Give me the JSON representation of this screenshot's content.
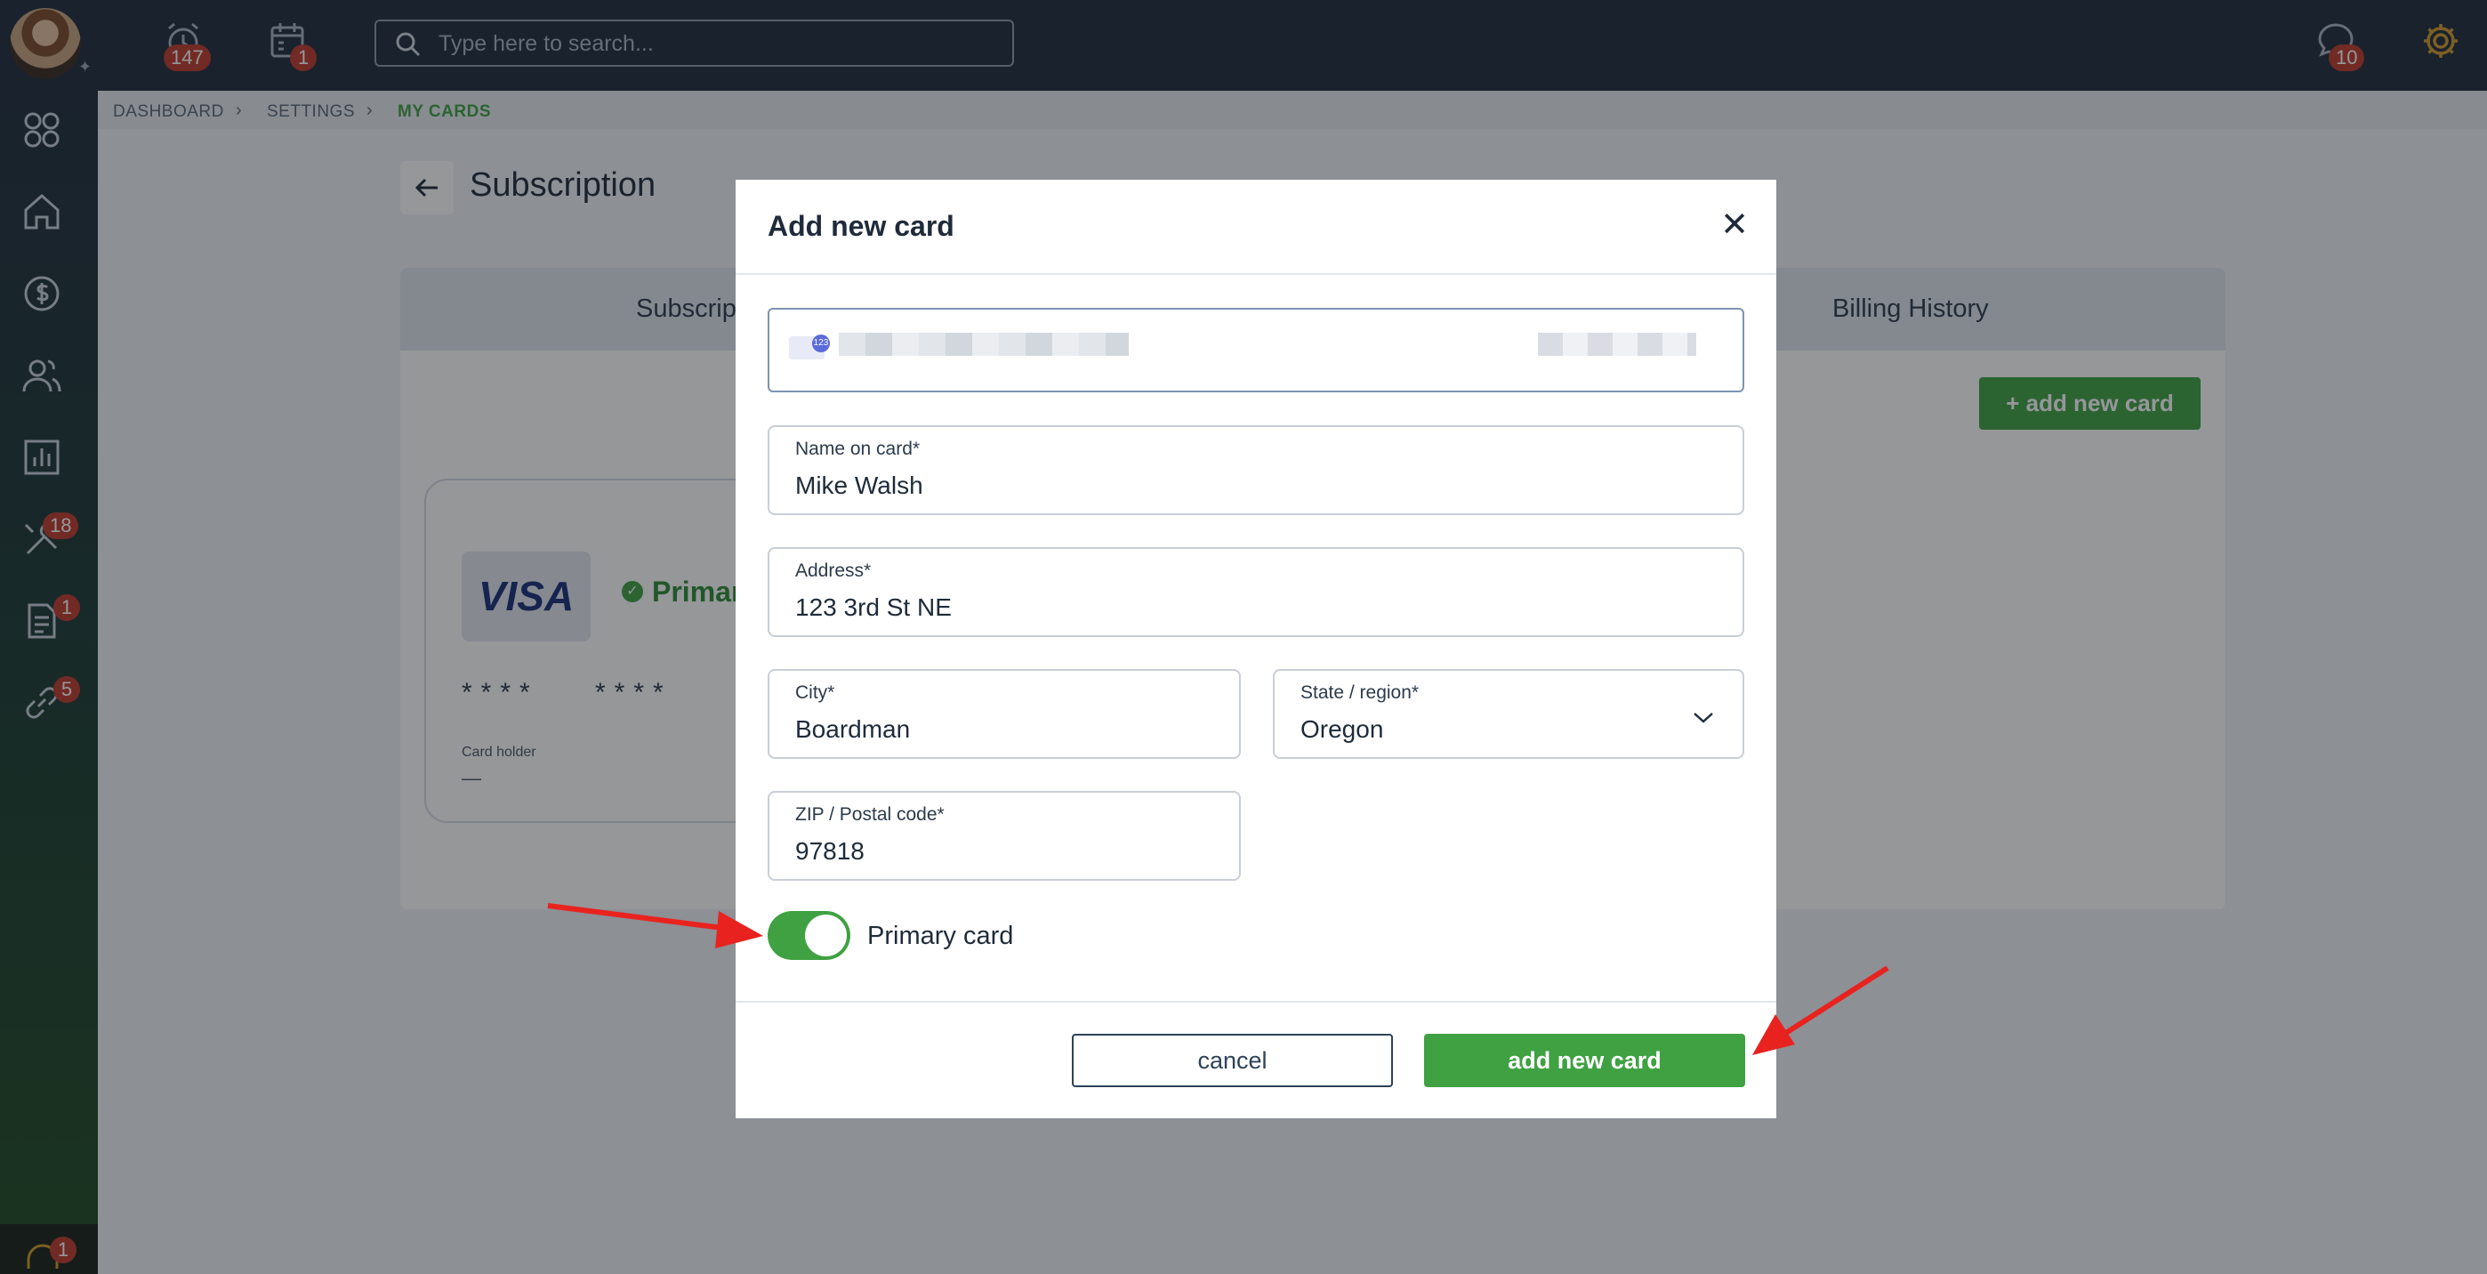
{
  "topbar": {
    "search_placeholder": "Type here to search...",
    "alarm_badge": "147",
    "calendar_badge": "1",
    "messages_badge": "10"
  },
  "sidebar": {
    "tools_badge": "18",
    "documents_badge": "1",
    "links_badge": "5",
    "support_badge": "1"
  },
  "breadcrumb": [
    "DASHBOARD",
    "SETTINGS",
    "MY CARDS"
  ],
  "page": {
    "title": "Subscription",
    "tabs": [
      "Subscrip",
      "Billing History"
    ],
    "add_card_label": "+ add new card",
    "card": {
      "brand": "VISA",
      "primary_label": "Primary",
      "masked_1": "****",
      "masked_2": "****",
      "holder_label": "Card holder",
      "holder_value": "—"
    }
  },
  "modal": {
    "title": "Add new card",
    "close_glyph": "✕",
    "card_icon_text": "123",
    "name_label": "Name on card*",
    "name_value": "Mike Walsh",
    "address_label": "Address*",
    "address_value": "123 3rd St NE",
    "city_label": "City*",
    "city_value": "Boardman",
    "state_label": "State / region*",
    "state_value": "Oregon",
    "zip_label": "ZIP / Postal code*",
    "zip_value": "97818",
    "primary_toggle_label": "Primary card",
    "primary_toggle_on": true,
    "cancel_label": "cancel",
    "submit_label": "add new card"
  },
  "colors": {
    "accent": "#3fa142",
    "topbar": "#1e2b3b",
    "badge": "#c0392b",
    "annotation_arrow": "#e8231f"
  }
}
